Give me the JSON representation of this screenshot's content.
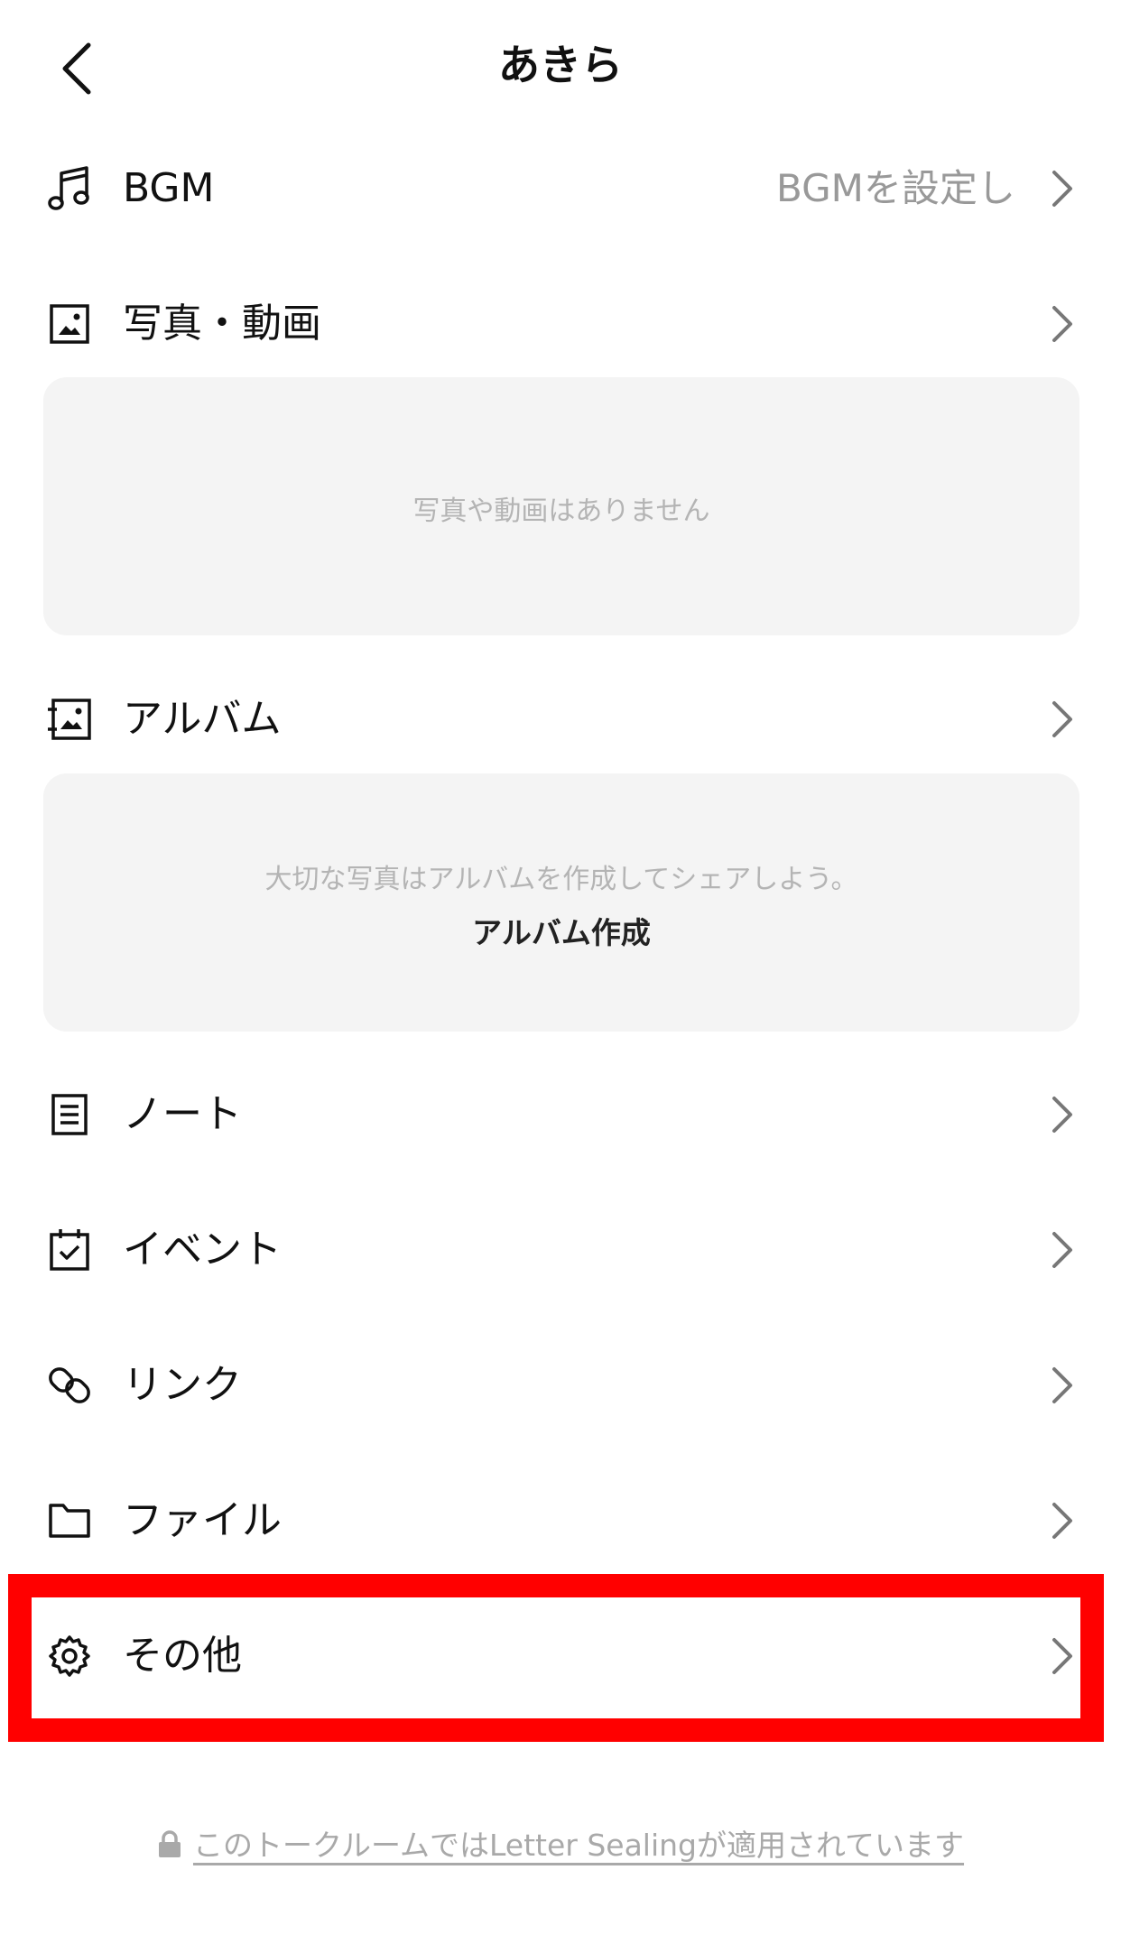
{
  "header": {
    "title": "あきら",
    "back_icon": "chevron-left-icon"
  },
  "rows": {
    "bgm": {
      "label": "BGM",
      "value": "BGMを設定し",
      "icon": "music-note-icon"
    },
    "photos": {
      "label": "写真・動画",
      "icon": "photo-icon"
    },
    "album": {
      "label": "アルバム",
      "icon": "album-icon"
    },
    "notes": {
      "label": "ノート",
      "icon": "note-icon"
    },
    "events": {
      "label": "イベント",
      "icon": "calendar-check-icon"
    },
    "links": {
      "label": "リンク",
      "icon": "link-icon"
    },
    "files": {
      "label": "ファイル",
      "icon": "folder-icon"
    },
    "other": {
      "label": "その他",
      "icon": "gear-icon"
    }
  },
  "photos_card": {
    "empty_text": "写真や動画はありません"
  },
  "album_card": {
    "prompt": "大切な写真はアルバムを作成してシェアしよう。",
    "action": "アルバム作成"
  },
  "footer": {
    "note": "このトークルームではLetter Sealingが適用されています",
    "icon": "lock-icon"
  },
  "colors": {
    "highlight": "#ff0000",
    "card_bg": "#f4f4f4",
    "muted_text": "#999999"
  }
}
